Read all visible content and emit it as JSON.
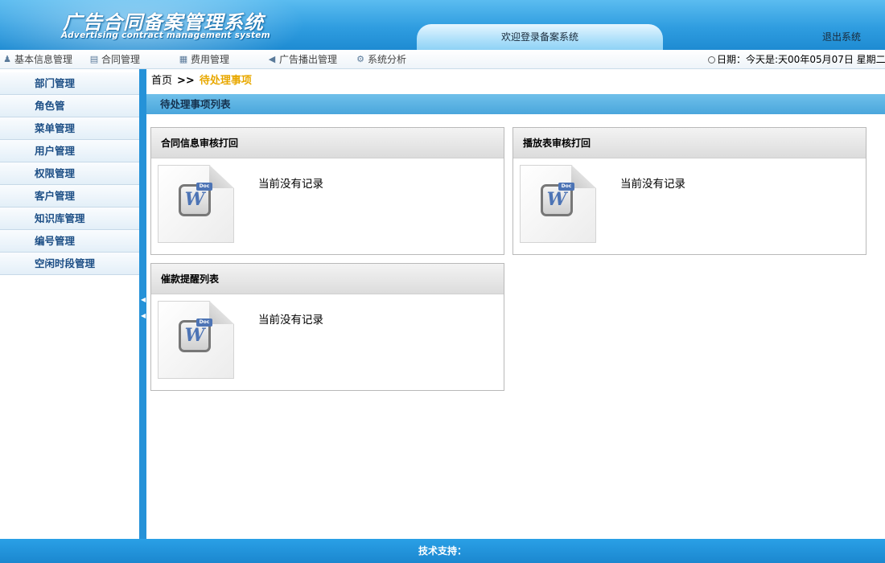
{
  "header": {
    "title_cn": "广告合同备案管理系统",
    "title_en": "Advertising contract management system",
    "welcome": "欢迎登录备案系统",
    "logout": "退出系统"
  },
  "nav": {
    "items": [
      {
        "label": "基本信息管理",
        "icon": "user-icon"
      },
      {
        "label": "合同管理",
        "icon": "calendar-icon"
      },
      {
        "label": "费用管理",
        "icon": "ledger-icon"
      },
      {
        "label": "广告播出管理",
        "icon": "speaker-icon"
      },
      {
        "label": "系统分析",
        "icon": "gear-icon"
      }
    ],
    "date": "日期：今天是:天00年05月07日 星期二"
  },
  "sidebar": {
    "items": [
      {
        "label": "部门管理"
      },
      {
        "label": "角色管"
      },
      {
        "label": "菜单管理"
      },
      {
        "label": "用户管理"
      },
      {
        "label": "权限管理"
      },
      {
        "label": "客户管理"
      },
      {
        "label": "知识库管理"
      },
      {
        "label": "编号管理"
      },
      {
        "label": "空闲时段管理"
      }
    ]
  },
  "breadcrumb": {
    "home": "首页",
    "separator": ">>",
    "current": "待处理事项"
  },
  "section_title": "待处理事项列表",
  "panels": [
    {
      "title": "合同信息审核打回",
      "empty_text": "当前没有记录",
      "doc_label": "W",
      "doc_tag": "Doc"
    },
    {
      "title": "播放表审核打回",
      "empty_text": "当前没有记录",
      "doc_label": "W",
      "doc_tag": "Doc"
    },
    {
      "title": "催款提醒列表",
      "empty_text": "当前没有记录",
      "doc_label": "W",
      "doc_tag": "Doc"
    }
  ],
  "footer": "技术支持：",
  "colors": {
    "header_blue": "#2f9de0",
    "sidebar_text": "#1d4f86",
    "breadcrumb_current": "#e8a800",
    "footer_blue": "#1b87cf"
  }
}
